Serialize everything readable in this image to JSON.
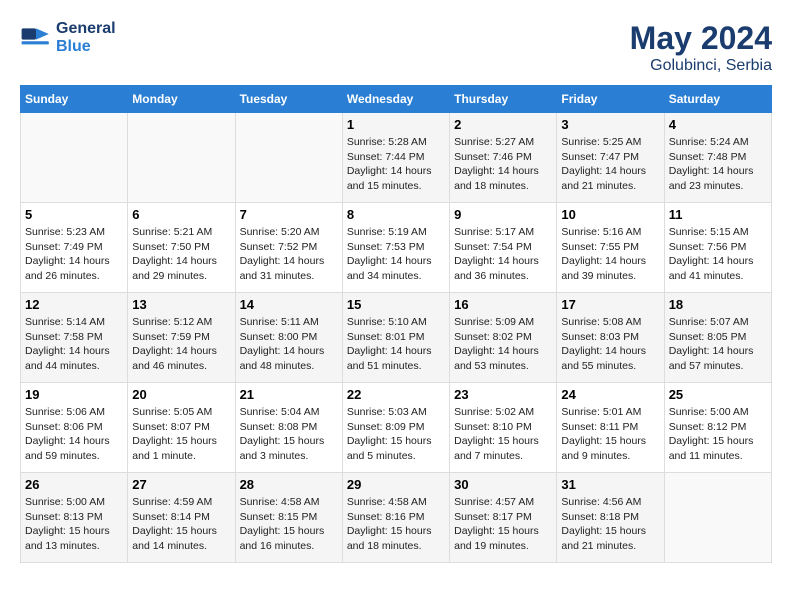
{
  "header": {
    "logo_line1": "General",
    "logo_line2": "Blue",
    "main_title": "May 2024",
    "subtitle": "Golubinci, Serbia"
  },
  "days_of_week": [
    "Sunday",
    "Monday",
    "Tuesday",
    "Wednesday",
    "Thursday",
    "Friday",
    "Saturday"
  ],
  "weeks": [
    [
      {
        "day": "",
        "info": ""
      },
      {
        "day": "",
        "info": ""
      },
      {
        "day": "",
        "info": ""
      },
      {
        "day": "1",
        "info": "Sunrise: 5:28 AM\nSunset: 7:44 PM\nDaylight: 14 hours\nand 15 minutes."
      },
      {
        "day": "2",
        "info": "Sunrise: 5:27 AM\nSunset: 7:46 PM\nDaylight: 14 hours\nand 18 minutes."
      },
      {
        "day": "3",
        "info": "Sunrise: 5:25 AM\nSunset: 7:47 PM\nDaylight: 14 hours\nand 21 minutes."
      },
      {
        "day": "4",
        "info": "Sunrise: 5:24 AM\nSunset: 7:48 PM\nDaylight: 14 hours\nand 23 minutes."
      }
    ],
    [
      {
        "day": "5",
        "info": "Sunrise: 5:23 AM\nSunset: 7:49 PM\nDaylight: 14 hours\nand 26 minutes."
      },
      {
        "day": "6",
        "info": "Sunrise: 5:21 AM\nSunset: 7:50 PM\nDaylight: 14 hours\nand 29 minutes."
      },
      {
        "day": "7",
        "info": "Sunrise: 5:20 AM\nSunset: 7:52 PM\nDaylight: 14 hours\nand 31 minutes."
      },
      {
        "day": "8",
        "info": "Sunrise: 5:19 AM\nSunset: 7:53 PM\nDaylight: 14 hours\nand 34 minutes."
      },
      {
        "day": "9",
        "info": "Sunrise: 5:17 AM\nSunset: 7:54 PM\nDaylight: 14 hours\nand 36 minutes."
      },
      {
        "day": "10",
        "info": "Sunrise: 5:16 AM\nSunset: 7:55 PM\nDaylight: 14 hours\nand 39 minutes."
      },
      {
        "day": "11",
        "info": "Sunrise: 5:15 AM\nSunset: 7:56 PM\nDaylight: 14 hours\nand 41 minutes."
      }
    ],
    [
      {
        "day": "12",
        "info": "Sunrise: 5:14 AM\nSunset: 7:58 PM\nDaylight: 14 hours\nand 44 minutes."
      },
      {
        "day": "13",
        "info": "Sunrise: 5:12 AM\nSunset: 7:59 PM\nDaylight: 14 hours\nand 46 minutes."
      },
      {
        "day": "14",
        "info": "Sunrise: 5:11 AM\nSunset: 8:00 PM\nDaylight: 14 hours\nand 48 minutes."
      },
      {
        "day": "15",
        "info": "Sunrise: 5:10 AM\nSunset: 8:01 PM\nDaylight: 14 hours\nand 51 minutes."
      },
      {
        "day": "16",
        "info": "Sunrise: 5:09 AM\nSunset: 8:02 PM\nDaylight: 14 hours\nand 53 minutes."
      },
      {
        "day": "17",
        "info": "Sunrise: 5:08 AM\nSunset: 8:03 PM\nDaylight: 14 hours\nand 55 minutes."
      },
      {
        "day": "18",
        "info": "Sunrise: 5:07 AM\nSunset: 8:05 PM\nDaylight: 14 hours\nand 57 minutes."
      }
    ],
    [
      {
        "day": "19",
        "info": "Sunrise: 5:06 AM\nSunset: 8:06 PM\nDaylight: 14 hours\nand 59 minutes."
      },
      {
        "day": "20",
        "info": "Sunrise: 5:05 AM\nSunset: 8:07 PM\nDaylight: 15 hours\nand 1 minute."
      },
      {
        "day": "21",
        "info": "Sunrise: 5:04 AM\nSunset: 8:08 PM\nDaylight: 15 hours\nand 3 minutes."
      },
      {
        "day": "22",
        "info": "Sunrise: 5:03 AM\nSunset: 8:09 PM\nDaylight: 15 hours\nand 5 minutes."
      },
      {
        "day": "23",
        "info": "Sunrise: 5:02 AM\nSunset: 8:10 PM\nDaylight: 15 hours\nand 7 minutes."
      },
      {
        "day": "24",
        "info": "Sunrise: 5:01 AM\nSunset: 8:11 PM\nDaylight: 15 hours\nand 9 minutes."
      },
      {
        "day": "25",
        "info": "Sunrise: 5:00 AM\nSunset: 8:12 PM\nDaylight: 15 hours\nand 11 minutes."
      }
    ],
    [
      {
        "day": "26",
        "info": "Sunrise: 5:00 AM\nSunset: 8:13 PM\nDaylight: 15 hours\nand 13 minutes."
      },
      {
        "day": "27",
        "info": "Sunrise: 4:59 AM\nSunset: 8:14 PM\nDaylight: 15 hours\nand 14 minutes."
      },
      {
        "day": "28",
        "info": "Sunrise: 4:58 AM\nSunset: 8:15 PM\nDaylight: 15 hours\nand 16 minutes."
      },
      {
        "day": "29",
        "info": "Sunrise: 4:58 AM\nSunset: 8:16 PM\nDaylight: 15 hours\nand 18 minutes."
      },
      {
        "day": "30",
        "info": "Sunrise: 4:57 AM\nSunset: 8:17 PM\nDaylight: 15 hours\nand 19 minutes."
      },
      {
        "day": "31",
        "info": "Sunrise: 4:56 AM\nSunset: 8:18 PM\nDaylight: 15 hours\nand 21 minutes."
      },
      {
        "day": "",
        "info": ""
      }
    ]
  ]
}
